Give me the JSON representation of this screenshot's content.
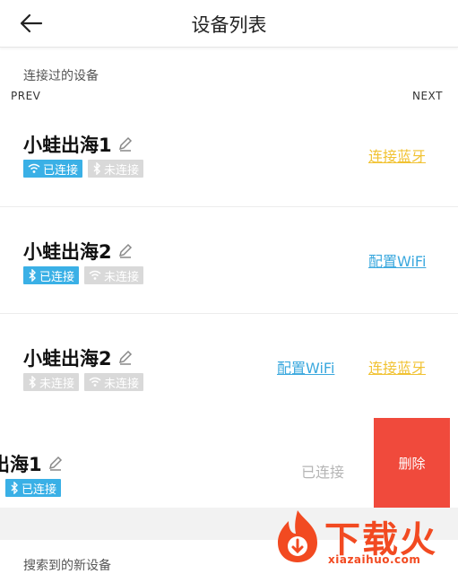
{
  "header": {
    "title": "设备列表",
    "back_icon": "arrow-left-icon"
  },
  "connected_section": {
    "label": "连接过的设备"
  },
  "carousel": {
    "prev": "PREV",
    "next": "NEXT"
  },
  "devices": [
    {
      "name": "小蛙出海1",
      "badges": [
        {
          "icon": "wifi-icon",
          "text": "已连接",
          "state": "on"
        },
        {
          "icon": "bluetooth-icon",
          "text": "未连接",
          "state": "off"
        }
      ],
      "actions": [
        {
          "label": "连接蓝牙",
          "type": "bluetooth"
        }
      ]
    },
    {
      "name": "小蛙出海2",
      "badges": [
        {
          "icon": "bluetooth-icon",
          "text": "已连接",
          "state": "on"
        },
        {
          "icon": "wifi-icon",
          "text": "未连接",
          "state": "off"
        }
      ],
      "actions": [
        {
          "label": "配置WiFi",
          "type": "wifi"
        }
      ]
    },
    {
      "name": "小蛙出海2",
      "badges": [
        {
          "icon": "bluetooth-icon",
          "text": "未连接",
          "state": "off"
        },
        {
          "icon": "wifi-icon",
          "text": "未连接",
          "state": "off"
        }
      ],
      "actions": [
        {
          "label": "配置WiFi",
          "type": "wifi"
        },
        {
          "label": "连接蓝牙",
          "type": "bluetooth"
        }
      ]
    },
    {
      "name": "出海1",
      "badges": [
        {
          "icon": "wifi-icon",
          "text": "",
          "state": "on"
        },
        {
          "icon": "bluetooth-icon",
          "text": "已连接",
          "state": "on"
        }
      ],
      "status": "已连接",
      "delete_label": "删除"
    }
  ],
  "search_section": {
    "label": "搜索到的新设备"
  },
  "watermark": {
    "text": "下载火",
    "url": "xiazaihuo.com"
  },
  "colors": {
    "accent_blue": "#3ab0e6",
    "bluetooth_link": "#f1c232",
    "wifi_link": "#3aa8de",
    "delete": "#f04a3c"
  }
}
